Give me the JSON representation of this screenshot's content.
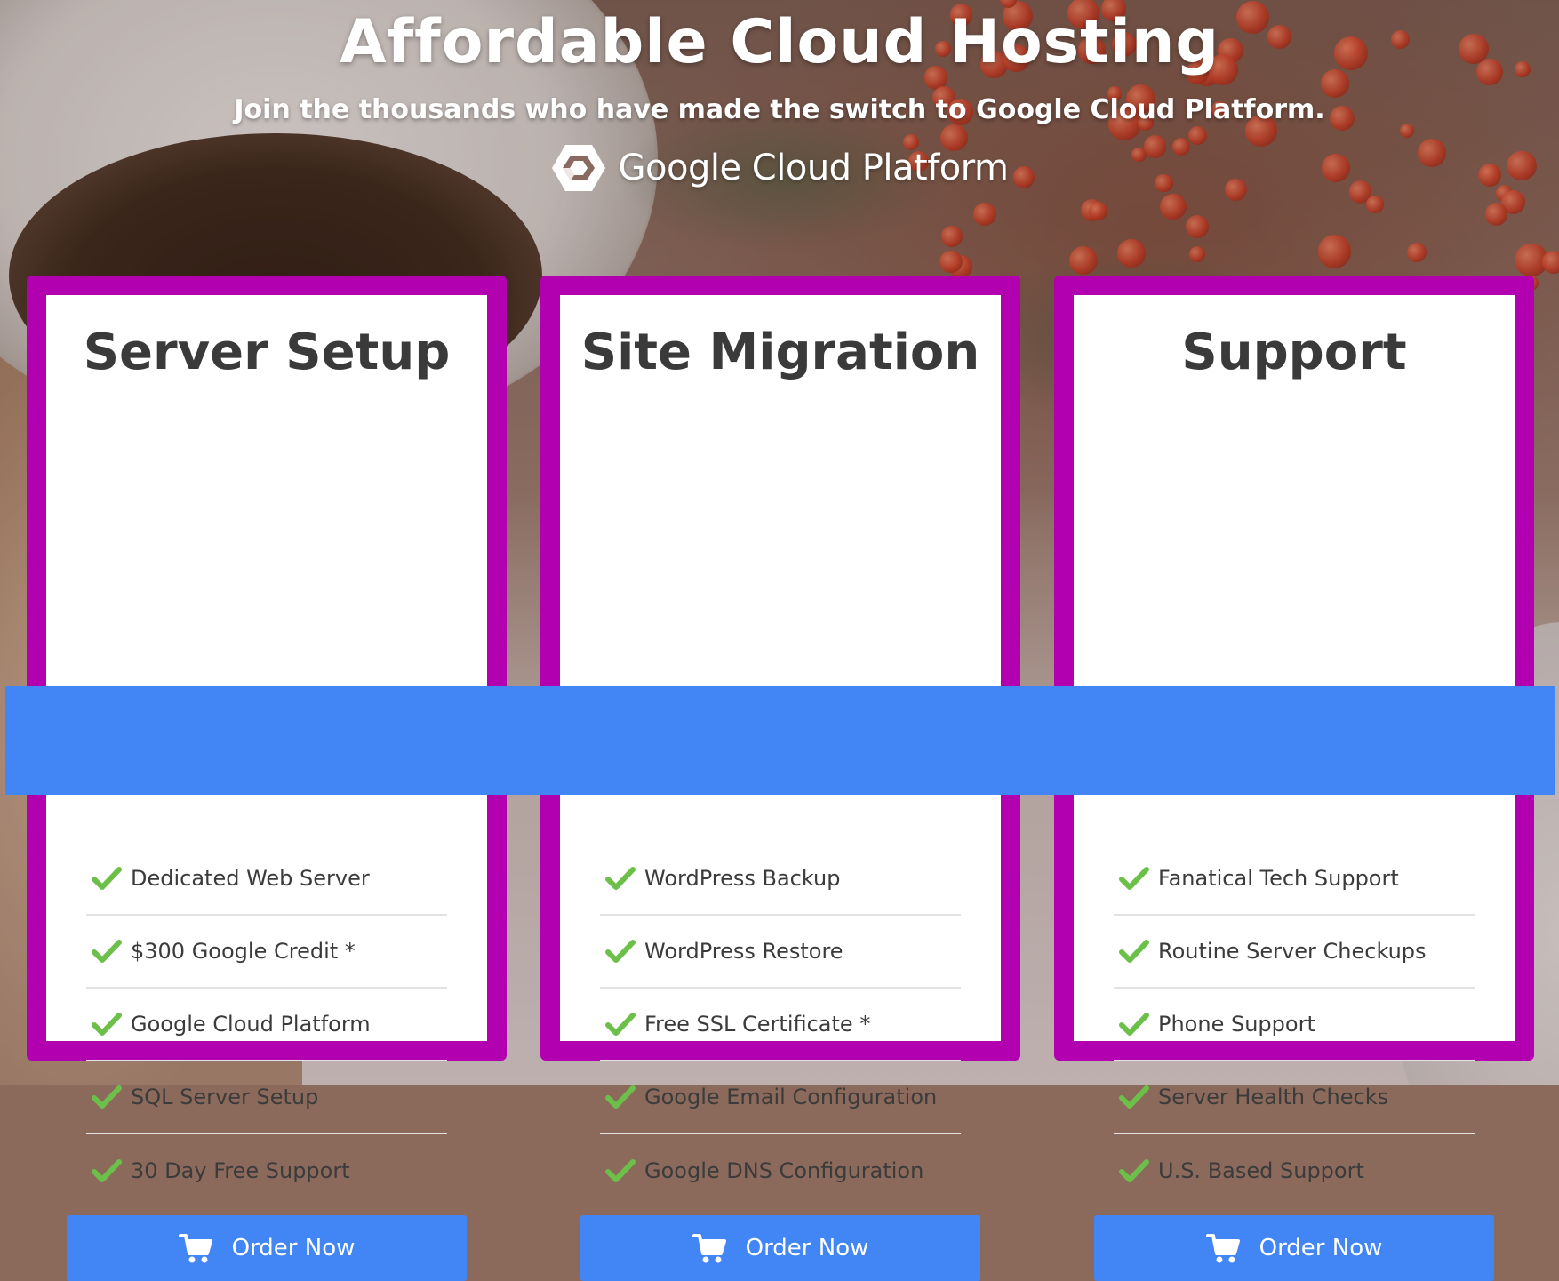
{
  "hero": {
    "title": "Affordable Cloud Hosting",
    "subtitle": "Join the thousands who have made the switch to Google Cloud Platform.",
    "logo": {
      "icon": "google-cloud-hexagon-icon",
      "wordmark": "Google Cloud Platform"
    }
  },
  "colors": {
    "card_border": "#b200b0",
    "accent_blue": "#4285f4",
    "check_green": "#6cc04a",
    "heading_text": "#3a3a3a"
  },
  "cards": [
    {
      "title": "Server Setup",
      "features": [
        "Dedicated Web Server",
        "$300 Google Credit *",
        "Google Cloud Platform",
        "SQL Server Setup",
        "30 Day Free Support"
      ],
      "button_label": "Order Now",
      "button_icon": "shopping-cart-icon"
    },
    {
      "title": "Site Migration",
      "features": [
        "WordPress Backup",
        "WordPress Restore",
        "Free SSL Certificate *",
        "Google Email Configuration",
        "Google DNS Configuration"
      ],
      "button_label": "Order Now",
      "button_icon": "shopping-cart-icon"
    },
    {
      "title": "Support",
      "features": [
        "Fanatical Tech Support",
        "Routine Server Checkups",
        "Phone Support",
        "Server Health Checks",
        "U.S. Based Support"
      ],
      "button_label": "Order Now",
      "button_icon": "shopping-cart-icon"
    }
  ]
}
